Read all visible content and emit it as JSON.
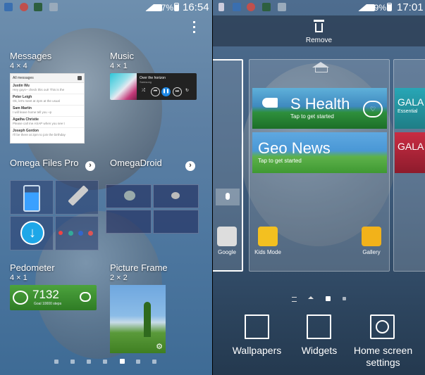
{
  "left": {
    "status": {
      "battery": "87%",
      "time": "16:54"
    },
    "widgets": {
      "messages": {
        "title": "Messages",
        "size": "4 × 4",
        "header": "All messages",
        "rows": [
          {
            "name": "Justin Wu",
            "text": "Hey guys~ check this out! This is the",
            "time": ""
          },
          {
            "name": "Peter Leigh",
            "text": "Ok, let's meet at 2pm at the usual",
            "time": ""
          },
          {
            "name": "Sam Martin",
            "text": "I will leave home tell you ~p",
            "time": ""
          },
          {
            "name": "Agatha Christie",
            "text": "Please call me ASAP when you see t",
            "time": ""
          },
          {
            "name": "Joseph Gordon",
            "text": "I'll be there at 2pm to join the birthday",
            "time": ""
          }
        ]
      },
      "music": {
        "title": "Music",
        "size": "4 × 1",
        "track": "Over the horizon",
        "artist": "Samsung"
      },
      "omega_files": {
        "title": "Omega Files Pro"
      },
      "omega_droid": {
        "title": "OmegaDroid"
      },
      "pedometer": {
        "title": "Pedometer",
        "size": "4 × 1",
        "steps": "7132",
        "goal": "Goal 10000 steps"
      },
      "picture_frame": {
        "title": "Picture Frame",
        "size": "2 × 2"
      }
    }
  },
  "right": {
    "status": {
      "battery": "89%",
      "time": "17:01"
    },
    "remove_label": "Remove",
    "tiles": {
      "shealth": {
        "title": "S Health",
        "subtitle": "Tap to get started"
      },
      "geonews": {
        "title": "Geo News",
        "subtitle": "Tap to get started"
      },
      "gala1": {
        "title": "GALA",
        "subtitle": "Essential"
      },
      "gala2": {
        "title": "GALA"
      }
    },
    "apps": {
      "google": "Google",
      "kids_mode": "Kids Mode",
      "gallery": "Gallery"
    },
    "bottom": {
      "wallpapers": "Wallpapers",
      "widgets": "Widgets",
      "home_settings": "Home screen settings"
    }
  },
  "colors": {
    "accent_blue": "#1e88e5",
    "pedometer_green": "#3c9a2f"
  }
}
